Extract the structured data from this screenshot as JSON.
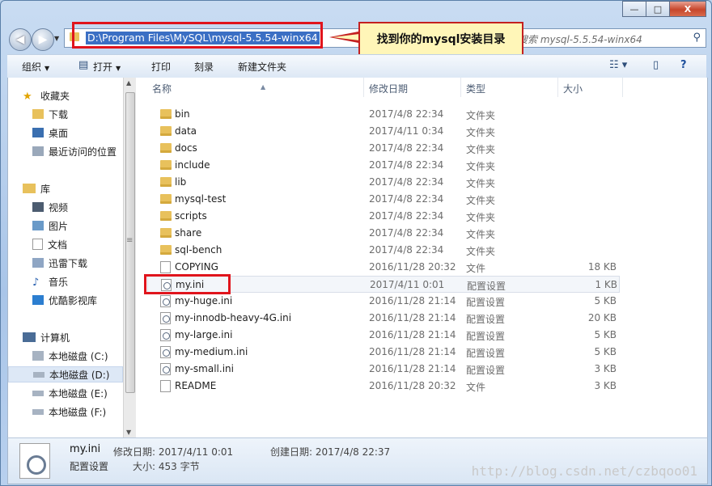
{
  "window": {
    "minimize": "—",
    "maximize": "□",
    "close": "X"
  },
  "nav": {
    "back_icon": "arrow-left-icon",
    "forward_icon": "arrow-right-icon"
  },
  "address": {
    "path": "D:\\Program Files\\MySQL\\mysql-5.5.54-winx64"
  },
  "search": {
    "placeholder": "搜索 mysql-5.5.54-winx64"
  },
  "callout": {
    "text": "找到你的mysql安装目录"
  },
  "toolbar": {
    "organize": "组织",
    "open": "打开",
    "print": "打印",
    "burn": "刻录",
    "new_folder": "新建文件夹"
  },
  "sidebar": {
    "favorites": "收藏夹",
    "favorite_items": [
      "下载",
      "桌面",
      "最近访问的位置"
    ],
    "libraries": "库",
    "library_items": [
      "视频",
      "图片",
      "文档",
      "迅雷下载",
      "音乐",
      "优酷影视库"
    ],
    "computer": "计算机",
    "drives": [
      "本地磁盘 (C:)",
      "本地磁盘 (D:)",
      "本地磁盘 (E:)",
      "本地磁盘 (F:)"
    ]
  },
  "columns": {
    "name": "名称",
    "date": "修改日期",
    "type": "类型",
    "size": "大小"
  },
  "files": [
    {
      "name": "bin",
      "date": "2017/4/8 22:34",
      "type": "文件夹",
      "size": "",
      "kind": "folder"
    },
    {
      "name": "data",
      "date": "2017/4/11 0:34",
      "type": "文件夹",
      "size": "",
      "kind": "folder"
    },
    {
      "name": "docs",
      "date": "2017/4/8 22:34",
      "type": "文件夹",
      "size": "",
      "kind": "folder"
    },
    {
      "name": "include",
      "date": "2017/4/8 22:34",
      "type": "文件夹",
      "size": "",
      "kind": "folder"
    },
    {
      "name": "lib",
      "date": "2017/4/8 22:34",
      "type": "文件夹",
      "size": "",
      "kind": "folder"
    },
    {
      "name": "mysql-test",
      "date": "2017/4/8 22:34",
      "type": "文件夹",
      "size": "",
      "kind": "folder"
    },
    {
      "name": "scripts",
      "date": "2017/4/8 22:34",
      "type": "文件夹",
      "size": "",
      "kind": "folder"
    },
    {
      "name": "share",
      "date": "2017/4/8 22:34",
      "type": "文件夹",
      "size": "",
      "kind": "folder"
    },
    {
      "name": "sql-bench",
      "date": "2017/4/8 22:34",
      "type": "文件夹",
      "size": "",
      "kind": "folder"
    },
    {
      "name": "COPYING",
      "date": "2016/11/28 20:32",
      "type": "文件",
      "size": "18 KB",
      "kind": "file"
    },
    {
      "name": "my.ini",
      "date": "2017/4/11 0:01",
      "type": "配置设置",
      "size": "1 KB",
      "kind": "ini"
    },
    {
      "name": "my-huge.ini",
      "date": "2016/11/28 21:14",
      "type": "配置设置",
      "size": "5 KB",
      "kind": "ini"
    },
    {
      "name": "my-innodb-heavy-4G.ini",
      "date": "2016/11/28 21:14",
      "type": "配置设置",
      "size": "20 KB",
      "kind": "ini"
    },
    {
      "name": "my-large.ini",
      "date": "2016/11/28 21:14",
      "type": "配置设置",
      "size": "5 KB",
      "kind": "ini"
    },
    {
      "name": "my-medium.ini",
      "date": "2016/11/28 21:14",
      "type": "配置设置",
      "size": "5 KB",
      "kind": "ini"
    },
    {
      "name": "my-small.ini",
      "date": "2016/11/28 21:14",
      "type": "配置设置",
      "size": "3 KB",
      "kind": "ini"
    },
    {
      "name": "README",
      "date": "2016/11/28 20:32",
      "type": "文件",
      "size": "3 KB",
      "kind": "file"
    }
  ],
  "details": {
    "name": "my.ini",
    "type": "配置设置",
    "modified": "修改日期: 2017/4/11 0:01",
    "created": "创建日期: 2017/4/8 22:37",
    "size": "大小: 453 字节"
  },
  "watermark": "http://blog.csdn.net/czbqoo01",
  "colors": {
    "accent_red": "#e0141c",
    "selection_blue": "#3b6fc4",
    "callout_bg": "#fff6b8"
  }
}
